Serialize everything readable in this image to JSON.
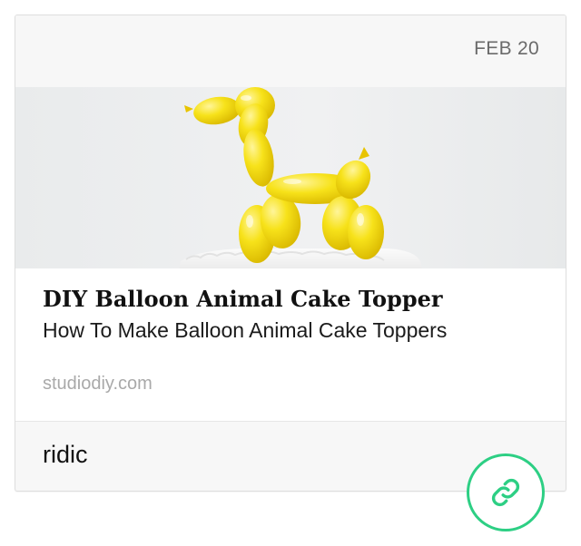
{
  "card": {
    "date": "FEB 20",
    "preview": {
      "image_icon": "balloon-dog-cake-topper-image",
      "title": "DIY Balloon Animal Cake Topper",
      "description": "How To Make Balloon Animal Cake Toppers",
      "domain": "studiodiy.com"
    },
    "note": "ridic"
  },
  "actions": {
    "link_icon": "link-icon"
  },
  "colors": {
    "accent": "#2dcf84",
    "card_background": "#f7f7f7",
    "balloon_yellow": "#f7e21a"
  }
}
